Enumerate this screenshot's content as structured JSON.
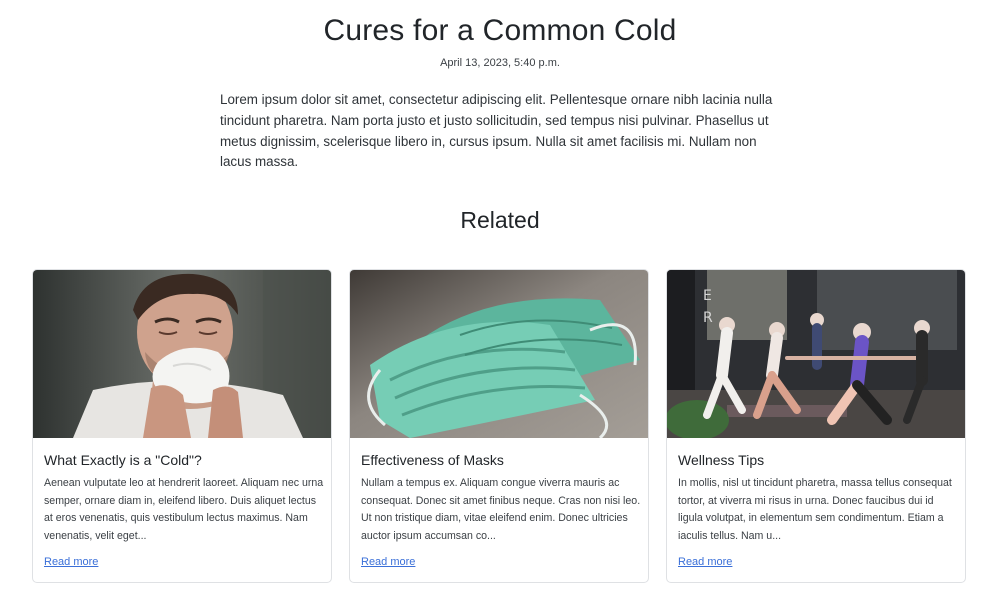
{
  "post": {
    "title": "Cures for a Common Cold",
    "date": "April 13, 2023, 5:40 p.m.",
    "body": "Lorem ipsum dolor sit amet, consectetur adipiscing elit. Pellentesque ornare nibh lacinia nulla tincidunt pharetra. Nam porta justo et justo sollicitudin, sed tempus nisi pulvinar. Phasellus ut metus dignissim, scelerisque libero in, cursus ipsum. Nulla sit amet facilisis mi. Nullam non lacus massa."
  },
  "related": {
    "heading": "Related",
    "cards": [
      {
        "title": "What Exactly is a \"Cold\"?",
        "text": "Aenean vulputate leo at hendrerit laoreet. Aliquam nec urna semper, ornare diam in, eleifend libero. Duis aliquet lectus at eros venenatis, quis vestibulum lectus maximus. Nam venenatis, velit eget...",
        "link": "Read more",
        "image": "man-blowing-nose-photo"
      },
      {
        "title": "Effectiveness of Masks",
        "text": "Nullam a tempus ex. Aliquam congue viverra mauris ac consequat. Donec sit amet finibus neque. Cras non nisi leo. Ut non tristique diam, vitae eleifend enim. Donec ultricies auctor ipsum accumsan co...",
        "link": "Read more",
        "image": "surgical-masks-photo"
      },
      {
        "title": "Wellness Tips",
        "text": "In mollis, nisl ut tincidunt pharetra, massa tellus consequat tortor, at viverra mi risus in urna. Donec faucibus dui id ligula volutpat, in elementum sem condimentum. Etiam a iaculis tellus. Nam u...",
        "link": "Read more",
        "image": "yoga-class-photo"
      }
    ]
  },
  "colors": {
    "link": "#3a6fd8",
    "card_border": "#dfe1e4",
    "text": "#212529"
  }
}
